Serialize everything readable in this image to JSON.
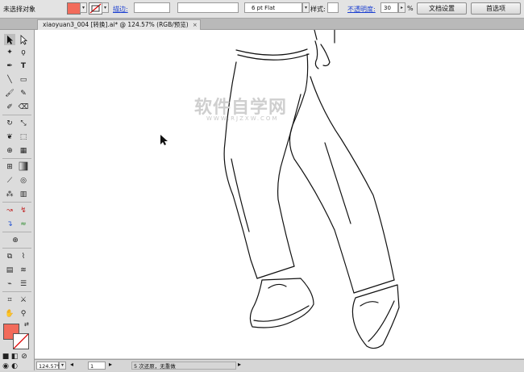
{
  "control_bar": {
    "selection_label": "未选择对象",
    "fill_color": "#f26b5b",
    "stroke_label": "描边:",
    "stroke_weight_value": "",
    "brush_value": "",
    "profile_value": "6 pt Flat",
    "style_label": "样式:",
    "opacity_label": "不透明度:",
    "opacity_value": "30",
    "opacity_unit": "%",
    "doc_setup_button": "文档设置",
    "prefs_button": "首选项"
  },
  "document_tab": {
    "title": "xiaoyuan3_004  [转换].ai* @ 124.57% (RGB/预览)",
    "close": "×"
  },
  "watermark": {
    "title": "软件自学网",
    "url": "WWW.RJZXW.COM"
  },
  "status_bar": {
    "zoom": "124.57%",
    "artboard": "1",
    "info": "5 次还原，无重做"
  },
  "colors": {
    "fill": "#f26b5b",
    "accent_link": "#1b3fd0"
  },
  "tools": [
    "selection-tool",
    "direct-selection-tool",
    "magic-wand-tool",
    "lasso-tool",
    "pen-tool",
    "type-tool",
    "line-segment-tool",
    "rectangle-tool",
    "paintbrush-tool",
    "pencil-tool",
    "blob-brush-tool",
    "eraser-tool",
    "rotate-tool",
    "scale-tool",
    "warp-tool",
    "free-transform-tool",
    "shape-builder-tool",
    "perspective-grid-tool",
    "mesh-tool",
    "gradient-tool",
    "eyedropper-tool",
    "blend-tool",
    "symbol-sprayer-tool",
    "column-graph-tool",
    "artboard-tool",
    "slice-tool",
    "hand-tool",
    "zoom-tool"
  ]
}
